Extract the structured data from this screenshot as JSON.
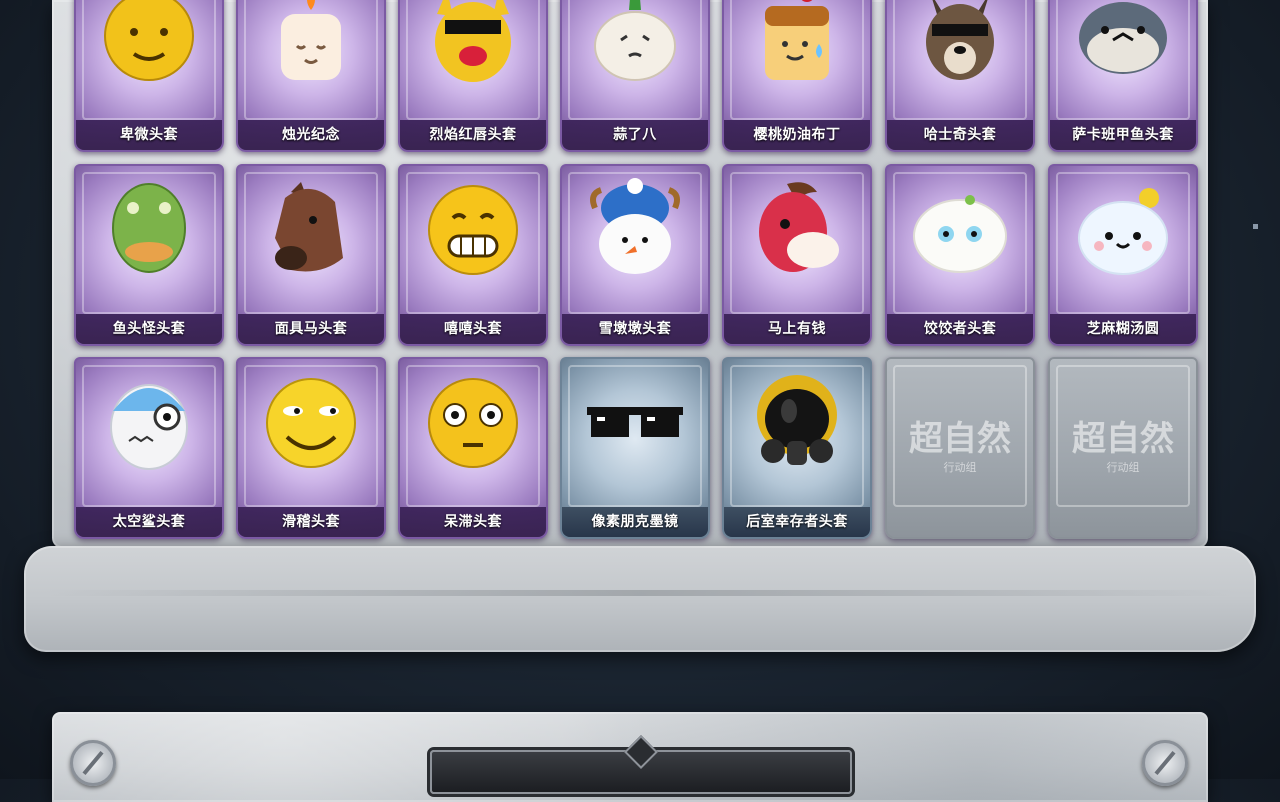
{
  "cards": [
    {
      "label": "卑微头套",
      "rarity": "purple",
      "icon": "meek-emoji-face-icon"
    },
    {
      "label": "烛光纪念",
      "rarity": "purple",
      "icon": "candle-face-icon"
    },
    {
      "label": "烈焰红唇头套",
      "rarity": "purple",
      "icon": "red-lips-pikachu-icon"
    },
    {
      "label": "蒜了八",
      "rarity": "purple",
      "icon": "garlic-face-icon"
    },
    {
      "label": "樱桃奶油布丁",
      "rarity": "purple",
      "icon": "cherry-pudding-icon"
    },
    {
      "label": "哈士奇头套",
      "rarity": "purple",
      "icon": "husky-head-icon"
    },
    {
      "label": "萨卡班甲鱼头套",
      "rarity": "purple",
      "icon": "sacabambaspis-fish-icon"
    },
    {
      "label": "鱼头怪头套",
      "rarity": "purple",
      "icon": "fish-monster-head-icon"
    },
    {
      "label": "面具马头套",
      "rarity": "purple",
      "icon": "horse-mask-icon"
    },
    {
      "label": "嘻嘻头套",
      "rarity": "purple",
      "icon": "grinning-emoji-icon"
    },
    {
      "label": "雪墩墩头套",
      "rarity": "purple",
      "icon": "snowman-head-icon"
    },
    {
      "label": "马上有钱",
      "rarity": "purple",
      "icon": "red-pony-head-icon"
    },
    {
      "label": "饺饺者头套",
      "rarity": "purple",
      "icon": "dumpling-head-icon"
    },
    {
      "label": "芝麻糊汤圆",
      "rarity": "purple",
      "icon": "rice-ball-head-icon"
    },
    {
      "label": "太空鲨头套",
      "rarity": "purple",
      "icon": "space-shark-head-icon"
    },
    {
      "label": "滑稽头套",
      "rarity": "purple",
      "icon": "smirk-emoji-icon"
    },
    {
      "label": "呆滞头套",
      "rarity": "purple",
      "icon": "dazed-emoji-icon"
    },
    {
      "label": "像素朋克墨镜",
      "rarity": "blue",
      "icon": "pixel-sunglasses-icon"
    },
    {
      "label": "后室幸存者头套",
      "rarity": "blue",
      "icon": "gas-mask-helmet-icon"
    },
    {
      "label": "",
      "rarity": "locked",
      "icon": "locked-slot-icon",
      "watermark": "超自然",
      "watermark_sub": "行动组"
    },
    {
      "label": "",
      "rarity": "locked",
      "icon": "locked-slot-icon",
      "watermark": "超自然",
      "watermark_sub": "行动组"
    }
  ],
  "bottom_panel": {
    "title": ""
  }
}
